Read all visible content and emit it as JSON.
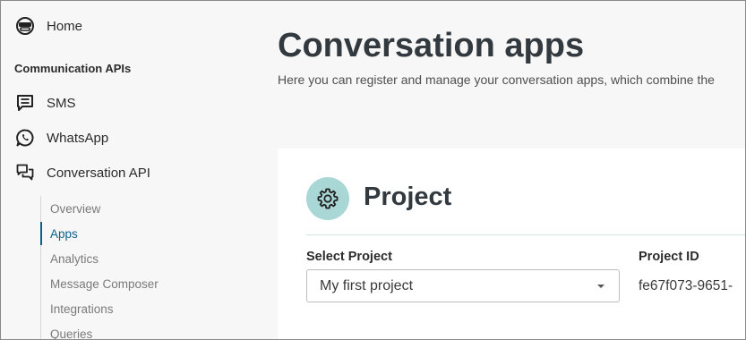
{
  "sidebar": {
    "home_label": "Home",
    "section_title": "Communication APIs",
    "items": [
      {
        "label": "SMS",
        "icon": "sms-icon"
      },
      {
        "label": "WhatsApp",
        "icon": "whatsapp-icon"
      },
      {
        "label": "Conversation API",
        "icon": "conversation-icon"
      }
    ],
    "subitems": [
      {
        "label": "Overview"
      },
      {
        "label": "Apps",
        "active": true
      },
      {
        "label": "Analytics"
      },
      {
        "label": "Message Composer"
      },
      {
        "label": "Integrations"
      },
      {
        "label": "Queries"
      }
    ]
  },
  "main": {
    "title": "Conversation apps",
    "subtitle": "Here you can register and manage your conversation apps, which combine the"
  },
  "card": {
    "title": "Project",
    "icon": "gear-icon",
    "select_label": "Select Project",
    "select_value": "My first project",
    "project_id_label": "Project ID",
    "project_id_value": "fe67f073-9651-"
  },
  "colors": {
    "accent": "#0b5f8a",
    "icon_circle": "#a8d7d6",
    "background": "#f7f7f7"
  }
}
